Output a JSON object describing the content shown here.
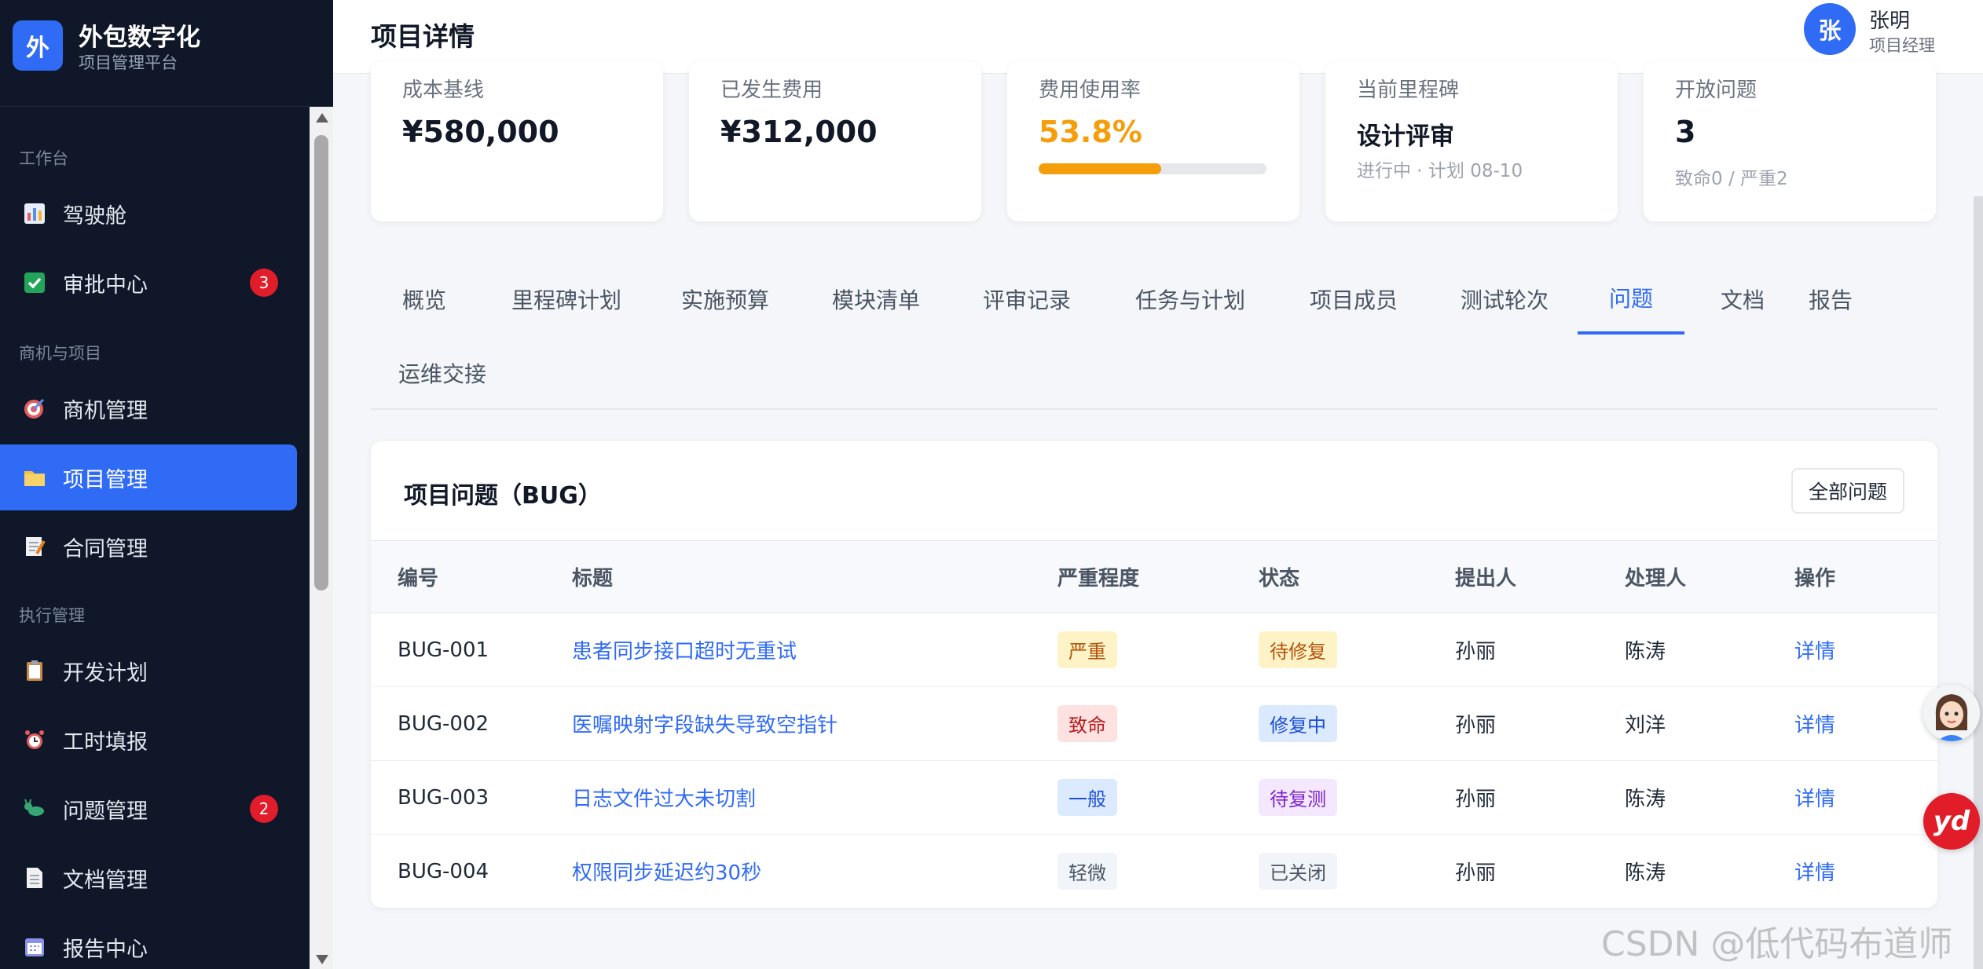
{
  "brand": {
    "logo_char": "外",
    "name": "外包数字化",
    "subtitle": "项目管理平台"
  },
  "sidebar": {
    "groups": [
      "工作台",
      "商机与项目",
      "执行管理"
    ],
    "items": [
      {
        "label": "驾驶舱",
        "icon": "chart-icon"
      },
      {
        "label": "审批中心",
        "icon": "check-icon",
        "badge": "3"
      },
      {
        "label": "商机管理",
        "icon": "target-icon"
      },
      {
        "label": "项目管理",
        "icon": "folder-icon",
        "active": true
      },
      {
        "label": "合同管理",
        "icon": "memo-icon"
      },
      {
        "label": "开发计划",
        "icon": "clipboard-icon"
      },
      {
        "label": "工时填报",
        "icon": "alarm-clock-icon"
      },
      {
        "label": "问题管理",
        "icon": "bug-icon",
        "badge": "2"
      },
      {
        "label": "文档管理",
        "icon": "document-icon"
      },
      {
        "label": "报告中心",
        "icon": "calendar-icon"
      }
    ]
  },
  "header": {
    "title": "项目详情",
    "user": {
      "avatar_char": "张",
      "name": "张明",
      "role": "项目经理"
    }
  },
  "stats": [
    {
      "label": "成本基线",
      "value": "¥580,000"
    },
    {
      "label": "已发生费用",
      "value": "¥312,000"
    },
    {
      "label": "费用使用率",
      "value": "53.8%",
      "progress": 0.538
    },
    {
      "label": "当前里程碑",
      "value": "设计评审",
      "sub": "进行中 · 计划 08-10"
    },
    {
      "label": "开放问题",
      "value": "3",
      "sub": "致命0 / 严重2"
    }
  ],
  "tabs": [
    "概览",
    "里程碑计划",
    "实施预算",
    "模块清单",
    "评审记录",
    "任务与计划",
    "项目成员",
    "测试轮次",
    "问题",
    "文档",
    "报告",
    "运维交接"
  ],
  "active_tab": "问题",
  "issues": {
    "title": "项目问题（BUG）",
    "all_button": "全部问题",
    "columns": [
      "编号",
      "标题",
      "严重程度",
      "状态",
      "提出人",
      "处理人",
      "操作"
    ],
    "rows": [
      {
        "id": "BUG-001",
        "title": "患者同步接口超时无重试",
        "severity": "严重",
        "status": "待修复",
        "reporter": "孙丽",
        "assignee": "陈涛",
        "action": "详情"
      },
      {
        "id": "BUG-002",
        "title": "医嘱映射字段缺失导致空指针",
        "severity": "致命",
        "status": "修复中",
        "reporter": "孙丽",
        "assignee": "刘洋",
        "action": "详情"
      },
      {
        "id": "BUG-003",
        "title": "日志文件过大未切割",
        "severity": "一般",
        "status": "待复测",
        "reporter": "孙丽",
        "assignee": "陈涛",
        "action": "详情"
      },
      {
        "id": "BUG-004",
        "title": "权限同步延迟约30秒",
        "severity": "轻微",
        "status": "已关闭",
        "reporter": "孙丽",
        "assignee": "陈涛",
        "action": "详情"
      }
    ]
  },
  "colors": {
    "accent": "#2f6bf5",
    "sidebar_bg": "#0f1729",
    "warning": "#f59e0b",
    "badge": "#e11d2a"
  },
  "float": {
    "yd_label": "yd"
  },
  "watermark": "CSDN @低代码布道师"
}
